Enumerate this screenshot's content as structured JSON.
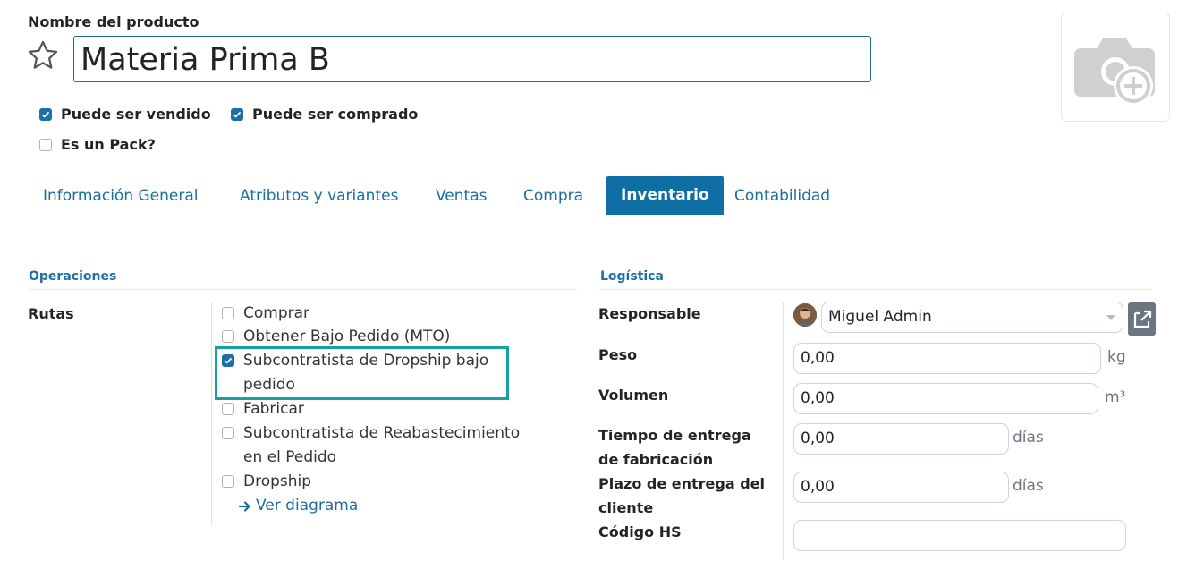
{
  "product": {
    "name_label": "Nombre del producto",
    "name_value": "Materia Prima B",
    "options": [
      {
        "label": "Puede ser vendido",
        "checked": true
      },
      {
        "label": "Puede ser comprado",
        "checked": true
      },
      {
        "label": "Es un Pack?",
        "checked": false
      }
    ]
  },
  "tabs": [
    {
      "label": "Información General",
      "active": false
    },
    {
      "label": "Atributos y variantes",
      "active": false
    },
    {
      "label": "Ventas",
      "active": false
    },
    {
      "label": "Compra",
      "active": false
    },
    {
      "label": "Inventario",
      "active": true
    },
    {
      "label": "Contabilidad",
      "active": false
    }
  ],
  "operaciones": {
    "title": "Operaciones",
    "rutas_label": "Rutas",
    "routes": [
      {
        "label": "Comprar",
        "checked": false
      },
      {
        "label": "Obtener Bajo Pedido (MTO)",
        "checked": false
      },
      {
        "label": "Subcontratista de Dropship bajo pedido",
        "checked": true,
        "highlighted": true
      },
      {
        "label": "Fabricar",
        "checked": false
      },
      {
        "label": "Subcontratista de Reabastecimiento en el Pedido",
        "checked": false
      },
      {
        "label": "Dropship",
        "checked": false
      }
    ],
    "diagram_link": "Ver diagrama"
  },
  "logistica": {
    "title": "Logística",
    "responsable_label": "Responsable",
    "responsable_value": "Miguel Admin",
    "peso_label": "Peso",
    "peso_value": "0,00",
    "peso_unit": "kg",
    "volumen_label": "Volumen",
    "volumen_value": "0,00",
    "volumen_unit": "m³",
    "tiempo_label": "Tiempo de entrega de fabricación",
    "tiempo_value": "0,00",
    "tiempo_unit": "días",
    "plazo_label": "Plazo de entrega del cliente",
    "plazo_value": "0,00",
    "plazo_unit": "días",
    "hs_label": "Código HS",
    "hs_value": ""
  },
  "colors": {
    "accent": "#0f6fa5",
    "highlight_box": "#17a2a2",
    "link": "#1a6fa0"
  },
  "icons": [
    "star-icon",
    "camera-add-icon",
    "arrow-right-icon",
    "external-link-icon",
    "avatar"
  ]
}
